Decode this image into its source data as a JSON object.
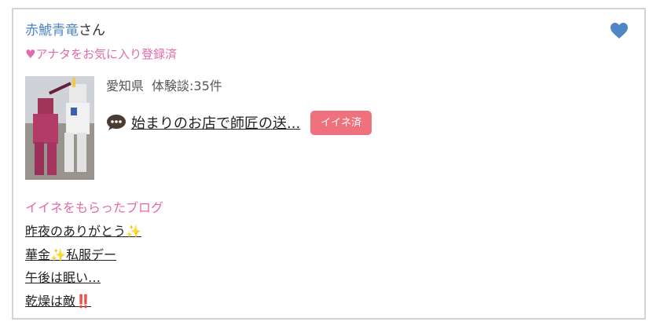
{
  "user": {
    "name": "赤鯱青竜",
    "honorific": "さん",
    "favorite_status": "♥アナタをお気に入り登録済",
    "favorite_icon": "heart-icon",
    "accent_color": "#4f86c6",
    "pink_color": "#e36aa8"
  },
  "profile": {
    "thumbnail_icon": "gundam-figure-photo",
    "prefecture": "愛知県",
    "review_count": "体験談:35件"
  },
  "review": {
    "icon": "speech-bubble-icon",
    "title": "始まりのお店で師匠の送...",
    "iine_label": "イイネ済",
    "badge_color": "#f0717e"
  },
  "blogs": {
    "heading": "イイネをもらったブログ",
    "items": [
      {
        "label": "昨夜のありがとう",
        "emoji": "✨"
      },
      {
        "label": "華金",
        "emoji": "✨",
        "suffix": "私服デー"
      },
      {
        "label": "午後は眠い…"
      },
      {
        "label": "乾燥は敵",
        "emoji": "‼️"
      }
    ]
  }
}
